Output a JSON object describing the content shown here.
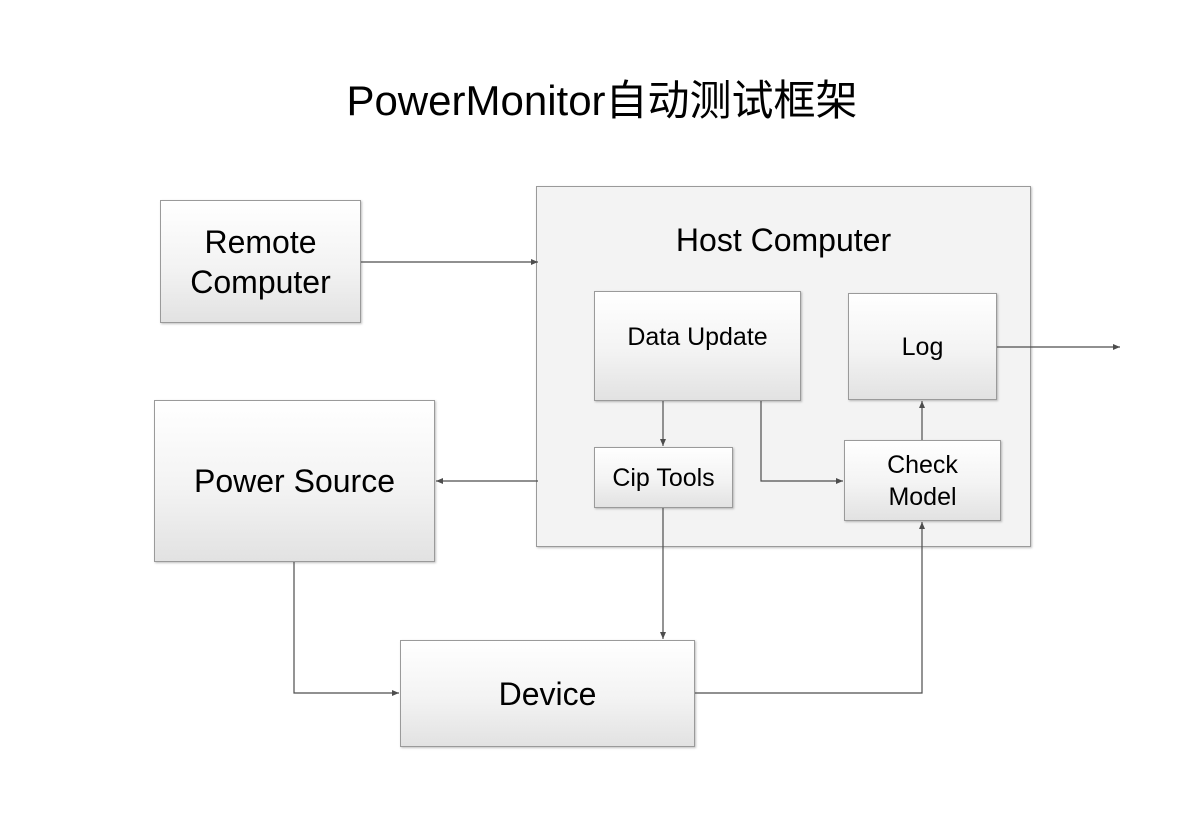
{
  "title": "PowerMonitor自动测试框架",
  "nodes": {
    "host_computer": "Host Computer",
    "remote_computer": [
      "Remote",
      "Computer"
    ],
    "power_source": "Power Source",
    "device": "Device",
    "data_update": "Data Update",
    "log": "Log",
    "cip_tools": "Cip Tools",
    "check_model": [
      "Check",
      "Model"
    ]
  },
  "colors": {
    "box_border": "#9a9a9a",
    "connector": "#4d4d4d",
    "box_fill_top": "#ffffff",
    "box_fill_bottom": "#e2e2e2"
  }
}
